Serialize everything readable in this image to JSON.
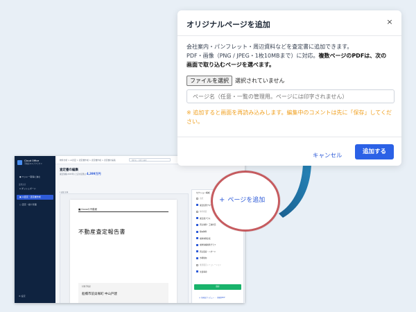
{
  "colors": {
    "accent": "#2b61e6",
    "warning": "#f0a020",
    "highlight_circle": "#c65b5f",
    "arrow": "#1b6f9e",
    "sidebar_bg": "#0f2340",
    "save_green": "#19b36b"
  },
  "app": {
    "logo_title": "Cloud Office",
    "logo_subtitle": "不動産マルチクラウド",
    "sidebar": {
      "items": [
        {
          "label": "● ヤジャー取得に進む"
        },
        {
          "label": "⌂ ダッシュボード"
        },
        {
          "label": "▣ AI査定・査定書作成"
        },
        {
          "label": "▢ 査定・媒介管理"
        }
      ],
      "section_label": "業務改善",
      "footer": "⚙ 設定"
    },
    "breadcrumb": "物件分析 > AI査定 > 査定書作成 > 査定書作成 > 査定書の編集",
    "search_placeholder": "物件名・住所で検索",
    "page_title": "査定書の編集",
    "meta_prefix": "査定価格(2025年) 上記の結果は",
    "meta_price": "4,399万円",
    "tab_line": "▾ 表紙  全体",
    "document": {
      "brand": "■ Kanaの不動産",
      "title": "不動産査定報告書",
      "box_label": "対象不動産",
      "box_text": "船橋市前貝塚町 中山戸建"
    },
    "right_panel": {
      "title": "セクション構成",
      "rows": [
        {
          "label": "表紙",
          "on": false
        },
        {
          "label": "査定結果サマリー",
          "on": true
        },
        {
          "label": "物件概要",
          "on": false
        },
        {
          "label": "査定書プラス",
          "on": true
        },
        {
          "label": "周辺事例・工事状況",
          "on": true
        },
        {
          "label": "類似物件",
          "on": true
        },
        {
          "label": "成約事例比較",
          "on": true
        },
        {
          "label": "成約価格推移グラフ",
          "on": true
        },
        {
          "label": "周辺環境・ハザード",
          "on": true
        },
        {
          "label": "市場動向",
          "on": true
        },
        {
          "label": "推奨販売シミュレーション",
          "on": false
        },
        {
          "label": "免責事項",
          "on": true
        }
      ],
      "save_label": "保存",
      "preview_label": "◎ 全画面プレビュー ・ 印刷用PDF"
    }
  },
  "callout": {
    "add_page_button": "ページを追加",
    "plus": "+"
  },
  "modal": {
    "title": "オリジナルページを追加",
    "close": "×",
    "desc_line1": "会社案内・パンフレット・周辺資料などを査定書に追加できます。",
    "desc_line2_plain": "PDF・画像（PNG / JPEG・1枚10MBまで）に対応。",
    "desc_line2_bold": "複数ページのPDFは、次の",
    "desc_line3_bold": "画面で取り込むページを選べます。",
    "file_button": "ファイルを選択",
    "file_status": "選択されていません",
    "page_name_placeholder": "ページ名（任意・一覧の管理用。ページには印字されません）",
    "warning": "※ 追加すると画面を再読み込みします。編集中のコメントは先に「保存」してください。",
    "cancel_label": "キャンセル",
    "submit_label": "追加する"
  }
}
